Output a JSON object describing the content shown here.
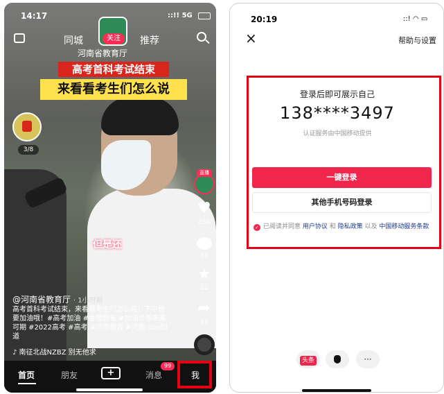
{
  "left_phone": {
    "status": {
      "time": "14:17",
      "signal": "::!! 5G"
    },
    "top_nav": {
      "city": "同城",
      "recommend": "推荐"
    },
    "logo_follow": "关注",
    "account_name_top": "河南省教育厅",
    "banner_line1": "高考首科考试结束",
    "banner_line2": "来看看考生们怎么说",
    "live_counter": "3/8",
    "live_badge": "直播",
    "right_bar": {
      "likes": "886",
      "comments": "66",
      "favorites": "22",
      "shares": "98"
    },
    "subtitle_overlay": "但是还",
    "caption": {
      "author": "@河南省教育厅",
      "time": "· 1小时前",
      "text": "高考首科考试结束，来看看考生们怎么说！下午也要加油哦！#高考加油 #金榜题名 #加油少年未来可期 #2022高考 #高考 #河南教育 #河南 dou知道",
      "music": "♪ 南征北战NZBZ  别无他求"
    },
    "bottom_tabs": {
      "home": "首页",
      "friends": "朋友",
      "plus": "+",
      "messages": "消息",
      "messages_badge": "99",
      "me": "我"
    },
    "colors": {
      "highlight": "#e60012",
      "accent": "#fe2c55"
    }
  },
  "right_phone": {
    "status": {
      "time": "20:19"
    },
    "close_icon": "×",
    "help_settings": "帮助与设置",
    "login_title": "登录后即可展示自己",
    "phone_number": "138****3497",
    "provider_note": "认证服务由中国移动提供",
    "one_click_login": "一键登录",
    "other_phone_login": "其他手机号码登录",
    "agreement": {
      "prefix": "已阅读并同意 ",
      "user_agreement": "用户协议",
      "and": " 和 ",
      "privacy": "隐私政策",
      "and2": " 以及 ",
      "cmcc": "中国移动服务条款"
    },
    "third_party": {
      "toutiao": "头条",
      "apple": "",
      "more": "···"
    },
    "colors": {
      "login_button": "#f0274d",
      "link": "#1e3a8a"
    }
  }
}
